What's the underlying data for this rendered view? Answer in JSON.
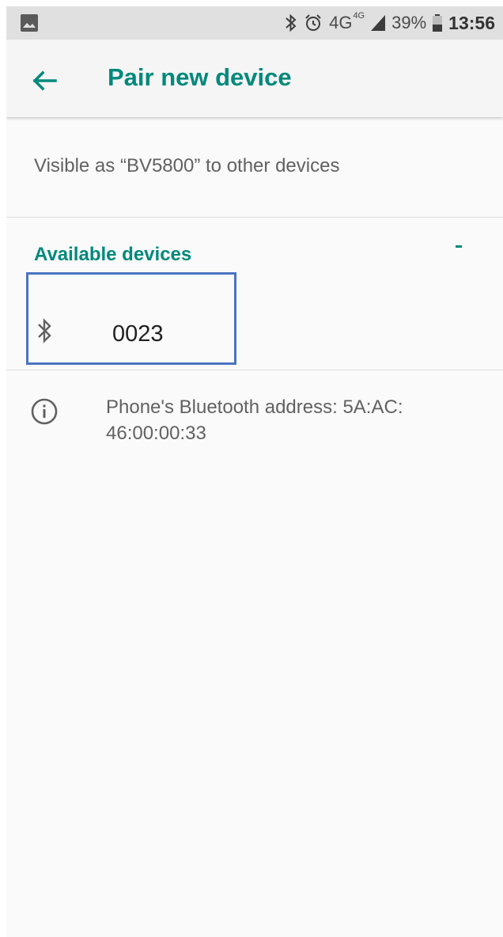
{
  "status_bar": {
    "network": "4G",
    "network_sup": "4G",
    "battery": "39%",
    "time": "13:56",
    "icons": [
      "image-icon",
      "bluetooth-icon",
      "alarm-icon",
      "signal-icon",
      "battery-icon"
    ]
  },
  "app_bar": {
    "title": "Pair new device",
    "back_icon": "arrow-back-icon"
  },
  "visibility": {
    "text": "Visible as “BV5800” to other devices"
  },
  "available_devices": {
    "header": "Available devices",
    "devices": [
      {
        "name": "0023",
        "icon": "bluetooth-icon"
      }
    ]
  },
  "footer_info": {
    "icon": "info-icon",
    "text": "Phone's Bluetooth address: 5A:AC: 46:00:00:33"
  },
  "colors": {
    "accent": "#00897b",
    "highlight_box": "#4a74c2"
  }
}
